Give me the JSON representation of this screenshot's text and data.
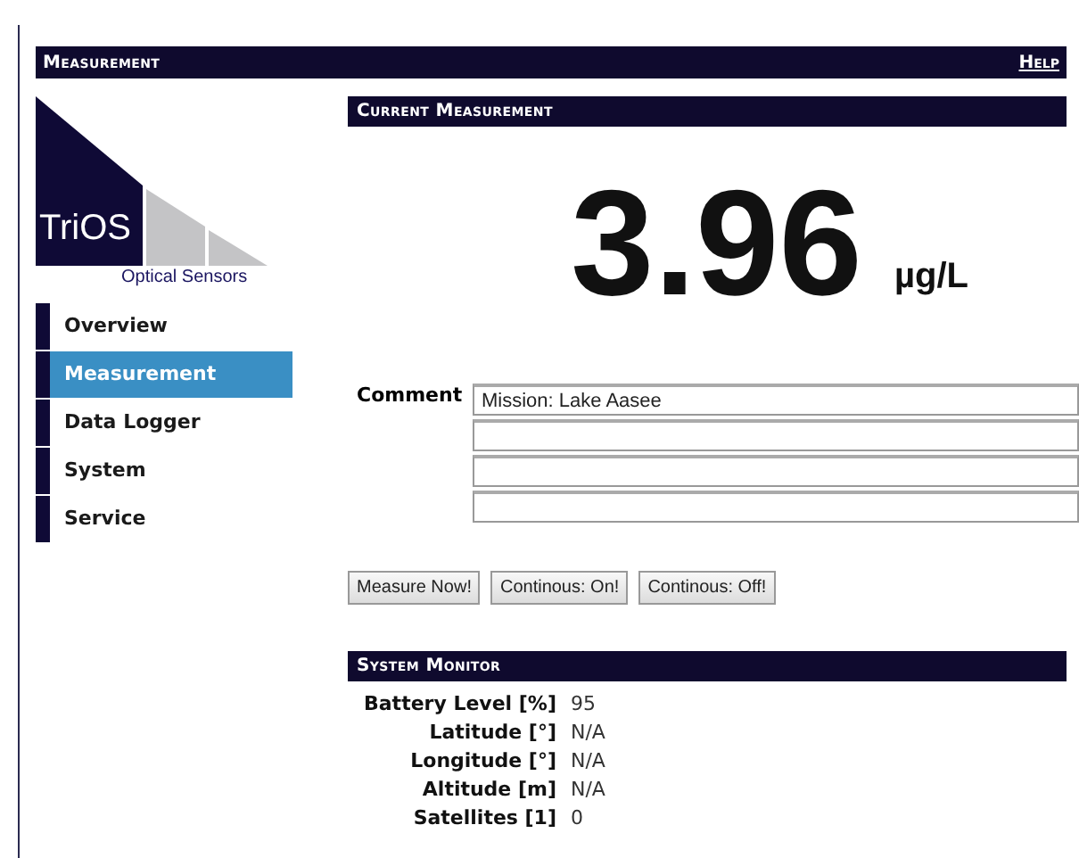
{
  "header": {
    "title": "Measurement",
    "help_link": "Help"
  },
  "logo": {
    "name": "TriOS",
    "tagline": "Optical Sensors"
  },
  "nav": [
    {
      "label": "Overview",
      "selected": false
    },
    {
      "label": "Measurement",
      "selected": true
    },
    {
      "label": "Data Logger",
      "selected": false
    },
    {
      "label": "System",
      "selected": false
    },
    {
      "label": "Service",
      "selected": false
    }
  ],
  "current_measurement": {
    "title": "Current Measurement",
    "value": "3.96",
    "unit": "µg/L"
  },
  "comment": {
    "label": "Comment",
    "fields": [
      {
        "kind": "text",
        "value": "Mission: Lake Aasee"
      },
      {
        "kind": "text"
      },
      {
        "kind": "text"
      },
      {
        "kind": "text"
      }
    ]
  },
  "buttons": [
    "Measure Now!",
    "Continous: On!",
    "Continous: Off!"
  ],
  "system_monitor": {
    "title": "System Monitor",
    "rows": [
      {
        "label": "Battery Level [%]",
        "value": "95"
      },
      {
        "label": "Latitude [°]",
        "value": "N/A"
      },
      {
        "label": "Longitude [°]",
        "value": "N/A"
      },
      {
        "label": "Altitude [m]",
        "value": "N/A"
      },
      {
        "label": "Satellites [1]",
        "value": "0"
      }
    ]
  }
}
